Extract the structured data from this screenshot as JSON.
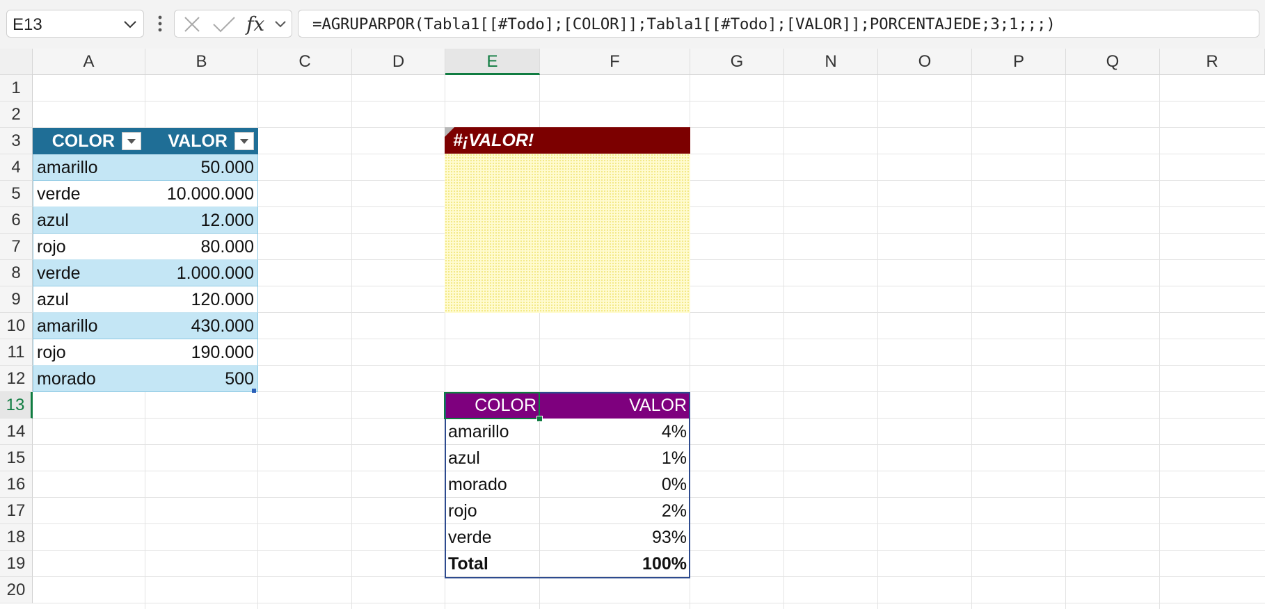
{
  "formula_bar": {
    "name_box": "E13",
    "formula": "=AGRUPARPOR(Tabla1[[#Todo];[COLOR]];Tabla1[[#Todo];[VALOR]];PORCENTAJEDE;3;1;;;)",
    "fx_label": "fx"
  },
  "columns": [
    "A",
    "B",
    "C",
    "D",
    "E",
    "F",
    "G",
    "N",
    "O",
    "P",
    "Q",
    "R"
  ],
  "active_column": "E",
  "rows": [
    "1",
    "2",
    "3",
    "4",
    "5",
    "6",
    "7",
    "8",
    "9",
    "10",
    "11",
    "12",
    "13",
    "14",
    "15",
    "16",
    "17",
    "18",
    "19",
    "20"
  ],
  "active_row": "13",
  "table1": {
    "headers": [
      "COLOR",
      "VALOR"
    ],
    "rows": [
      [
        "amarillo",
        "50.000"
      ],
      [
        "verde",
        "10.000.000"
      ],
      [
        "azul",
        "12.000"
      ],
      [
        "rojo",
        "80.000"
      ],
      [
        "verde",
        "1.000.000"
      ],
      [
        "azul",
        "120.000"
      ],
      [
        "amarillo",
        "430.000"
      ],
      [
        "rojo",
        "190.000"
      ],
      [
        "morado",
        "500"
      ]
    ],
    "header_color": "#1f6e96",
    "band_color": "#c4e6f5"
  },
  "error": {
    "text": "#¡VALOR!",
    "color": "#7c0000"
  },
  "result": {
    "headers": [
      "COLOR",
      "VALOR"
    ],
    "rows": [
      [
        "amarillo",
        "4%"
      ],
      [
        "azul",
        "1%"
      ],
      [
        "morado",
        "0%"
      ],
      [
        "rojo",
        "2%"
      ],
      [
        "verde",
        "93%"
      ]
    ],
    "total": [
      "Total",
      "100%"
    ],
    "header_color": "#7e007e"
  }
}
